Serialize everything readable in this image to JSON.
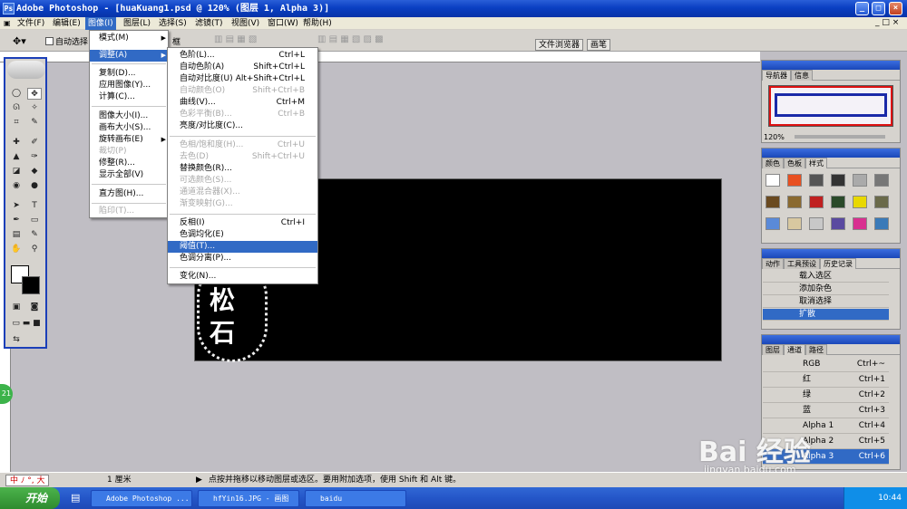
{
  "window": {
    "title": "Adobe Photoshop - [huaKuang1.psd @ 120% (图层 1, Alpha 3)]",
    "logo": "Ps"
  },
  "menubar": [
    {
      "label": "文件(F)"
    },
    {
      "label": "编辑(E)"
    },
    {
      "label": "图像(I)"
    },
    {
      "label": "图层(L)"
    },
    {
      "label": "选择(S)"
    },
    {
      "label": "滤镜(T)"
    },
    {
      "label": "视图(V)"
    },
    {
      "label": "窗口(W)"
    },
    {
      "label": "帮助(H)"
    }
  ],
  "options": {
    "auto_select_label": "自动选择",
    "frame_label": "框",
    "file_browser_tab": "文件浏览器",
    "brush_tab": "画笔"
  },
  "image_menu": {
    "items": [
      {
        "label": "模式(M)",
        "submenu": true
      },
      {
        "label": "调整(A)",
        "submenu": true,
        "selected": true
      },
      {
        "label": "复制(D)..."
      },
      {
        "label": "应用图像(Y)..."
      },
      {
        "label": "计算(C)..."
      },
      {
        "label": "图像大小(I)..."
      },
      {
        "label": "画布大小(S)..."
      },
      {
        "label": "旋转画布(E)",
        "submenu": true
      },
      {
        "label": "裁切(P)",
        "disabled": true
      },
      {
        "label": "修整(R)..."
      },
      {
        "label": "显示全部(V)"
      },
      {
        "label": "直方图(H)..."
      },
      {
        "label": "陷印(T)...",
        "disabled": true
      }
    ]
  },
  "adjust_menu": {
    "items": [
      {
        "label": "色阶(L)...",
        "shortcut": "Ctrl+L"
      },
      {
        "label": "自动色阶(A)",
        "shortcut": "Shift+Ctrl+L"
      },
      {
        "label": "自动对比度(U)",
        "shortcut": "Alt+Shift+Ctrl+L"
      },
      {
        "label": "自动颜色(O)",
        "shortcut": "Shift+Ctrl+B",
        "disabled": true
      },
      {
        "label": "曲线(V)...",
        "shortcut": "Ctrl+M"
      },
      {
        "label": "色彩平衡(B)...",
        "shortcut": "Ctrl+B",
        "disabled": true
      },
      {
        "label": "亮度/对比度(C)...",
        "shortcut": ""
      },
      {
        "label": "色相/饱和度(H)...",
        "shortcut": "Ctrl+U",
        "disabled": true
      },
      {
        "label": "去色(D)",
        "shortcut": "Shift+Ctrl+U",
        "disabled": true
      },
      {
        "label": "替换颜色(R)...",
        "shortcut": ""
      },
      {
        "label": "可选颜色(S)...",
        "shortcut": "",
        "disabled": true
      },
      {
        "label": "通道混合器(X)...",
        "shortcut": "",
        "disabled": true
      },
      {
        "label": "渐变映射(G)...",
        "shortcut": "",
        "disabled": true
      },
      {
        "label": "反相(I)",
        "shortcut": "Ctrl+I"
      },
      {
        "label": "色调均化(E)",
        "shortcut": ""
      },
      {
        "label": "阈值(T)...",
        "shortcut": "",
        "selected": true
      },
      {
        "label": "色调分离(P)...",
        "shortcut": ""
      },
      {
        "label": "变化(N)...",
        "shortcut": ""
      }
    ]
  },
  "canvas": {
    "stamp_text_1": "松",
    "stamp_text_2": "石"
  },
  "navigator": {
    "tabs": [
      "导航器",
      "信息"
    ],
    "zoom": "120%"
  },
  "swatches": {
    "tabs": [
      "颜色",
      "色板",
      "样式"
    ]
  },
  "history": {
    "tabs": [
      "动作",
      "工具预设",
      "历史记录"
    ],
    "items": [
      {
        "label": "载入选区"
      },
      {
        "label": "添加杂色"
      },
      {
        "label": "取消选择"
      },
      {
        "label": "扩散",
        "selected": true
      }
    ]
  },
  "channels": {
    "tabs": [
      "图层",
      "通道",
      "路径"
    ],
    "items": [
      {
        "name": "RGB",
        "shortcut": "Ctrl+~"
      },
      {
        "name": "红",
        "shortcut": "Ctrl+1"
      },
      {
        "name": "绿",
        "shortcut": "Ctrl+2"
      },
      {
        "name": "蓝",
        "shortcut": "Ctrl+3"
      },
      {
        "name": "Alpha 1",
        "shortcut": "Ctrl+4"
      },
      {
        "name": "Alpha 2",
        "shortcut": "Ctrl+5"
      },
      {
        "name": "Alpha 3",
        "shortcut": "Ctrl+6",
        "selected": true
      }
    ]
  },
  "statusbar": {
    "ime": "中 ﾉ °, 大",
    "size": "1 厘米",
    "hint": "点按并拖移以移动图层或选区。要用附加选项，使用 Shift 和 Alt 键。"
  },
  "taskbar": {
    "start": "开始",
    "tasks": [
      "Adobe Photoshop ...",
      "hfYin16.JPG - 画图",
      "baidu"
    ],
    "time": "10:44"
  },
  "watermark": {
    "text": "Bai 经验",
    "url": "jingyan.baidu.com"
  },
  "ruler": {
    "side_badge": "21"
  },
  "colors": {
    "xp_blue": "#0a3fc2",
    "menu_highlight": "#316ac5",
    "canvas_bg": "#000000",
    "workspace": "#c0bec4"
  }
}
